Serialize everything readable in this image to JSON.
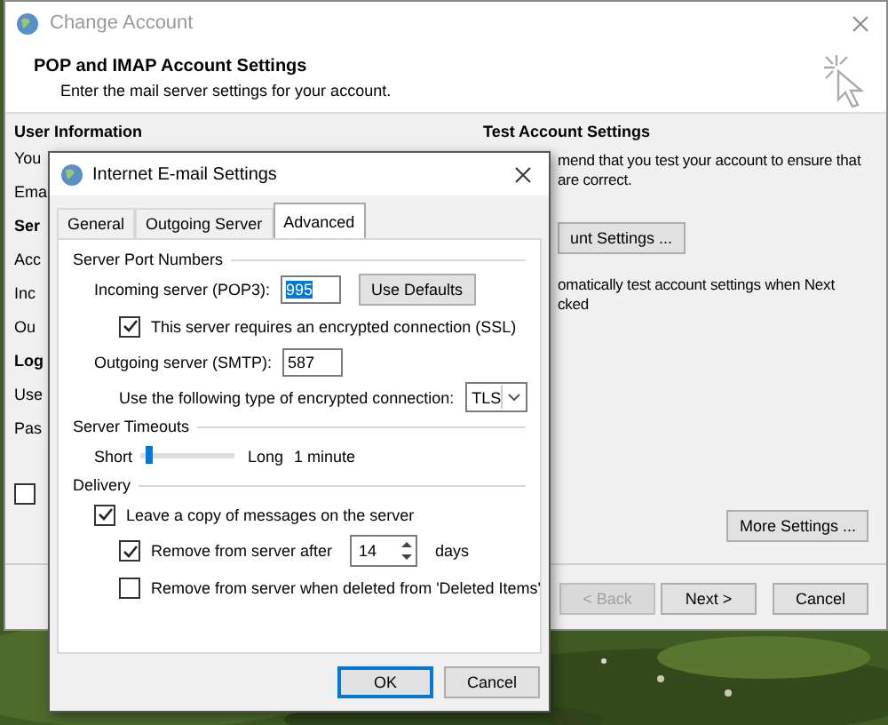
{
  "background_window": {
    "title": "Change Account",
    "heading": "POP and IMAP Account Settings",
    "subheading": "Enter the mail server settings for your account.",
    "left_column": {
      "heading": "User Information",
      "items": [
        {
          "kind": "label",
          "text": "You"
        },
        {
          "kind": "label",
          "text": "Ema"
        },
        {
          "kind": "heading",
          "text": "Ser"
        },
        {
          "kind": "label",
          "text": "Acc"
        },
        {
          "kind": "label",
          "text": "Inc"
        },
        {
          "kind": "label",
          "text": "Ou"
        },
        {
          "kind": "heading",
          "text": "Log"
        },
        {
          "kind": "label",
          "text": "Use"
        },
        {
          "kind": "label",
          "text": "Pas"
        },
        {
          "kind": "checkbox",
          "checked": false
        }
      ]
    },
    "right_column": {
      "heading": "Test Account Settings",
      "description_lines": [
        "mend that you test your account to ensure that",
        "are correct."
      ],
      "test_button": "unt Settings ...",
      "auto_test_lines": [
        "omatically test account settings when Next",
        "cked"
      ]
    },
    "more_settings_button": "More Settings ...",
    "buttons": [
      {
        "label": "< Back",
        "disabled": true
      },
      {
        "label": "Next >",
        "disabled": false
      },
      {
        "label": "Cancel",
        "disabled": false
      }
    ]
  },
  "dialog": {
    "title": "Internet E-mail Settings",
    "tabs": [
      {
        "label": "General",
        "selected": false
      },
      {
        "label": "Outgoing Server",
        "selected": false
      },
      {
        "label": "Advanced",
        "selected": true
      }
    ],
    "server_ports": {
      "heading": "Server Port Numbers",
      "incoming": {
        "label": "Incoming server (POP3):",
        "value": "995",
        "highlighted": true
      },
      "defaults_button": "Use Defaults",
      "ssl": {
        "label": "This server requires an encrypted connection (SSL)",
        "checked": true
      },
      "outgoing": {
        "label": "Outgoing server (SMTP):",
        "value": "587",
        "highlighted": false
      },
      "encryption": {
        "label": "Use the following type of encrypted connection:",
        "value": "TLS"
      }
    },
    "timeouts": {
      "heading": "Server Timeouts",
      "min_label": "Short",
      "max_label": "Long",
      "level": 0.1,
      "reading": "1 minute"
    },
    "delivery": {
      "heading": "Delivery",
      "leave_copy": {
        "label": "Leave a copy of messages on the server",
        "checked": true
      },
      "remove_after": {
        "label": "Remove from server after",
        "checked": true,
        "value": "14",
        "unit": "days"
      },
      "remove_deleted": {
        "label": "Remove from server when deleted from 'Deleted Items'",
        "checked": false
      }
    },
    "buttons": [
      {
        "label": "OK",
        "default": true
      },
      {
        "label": "Cancel",
        "default": false
      }
    ]
  }
}
